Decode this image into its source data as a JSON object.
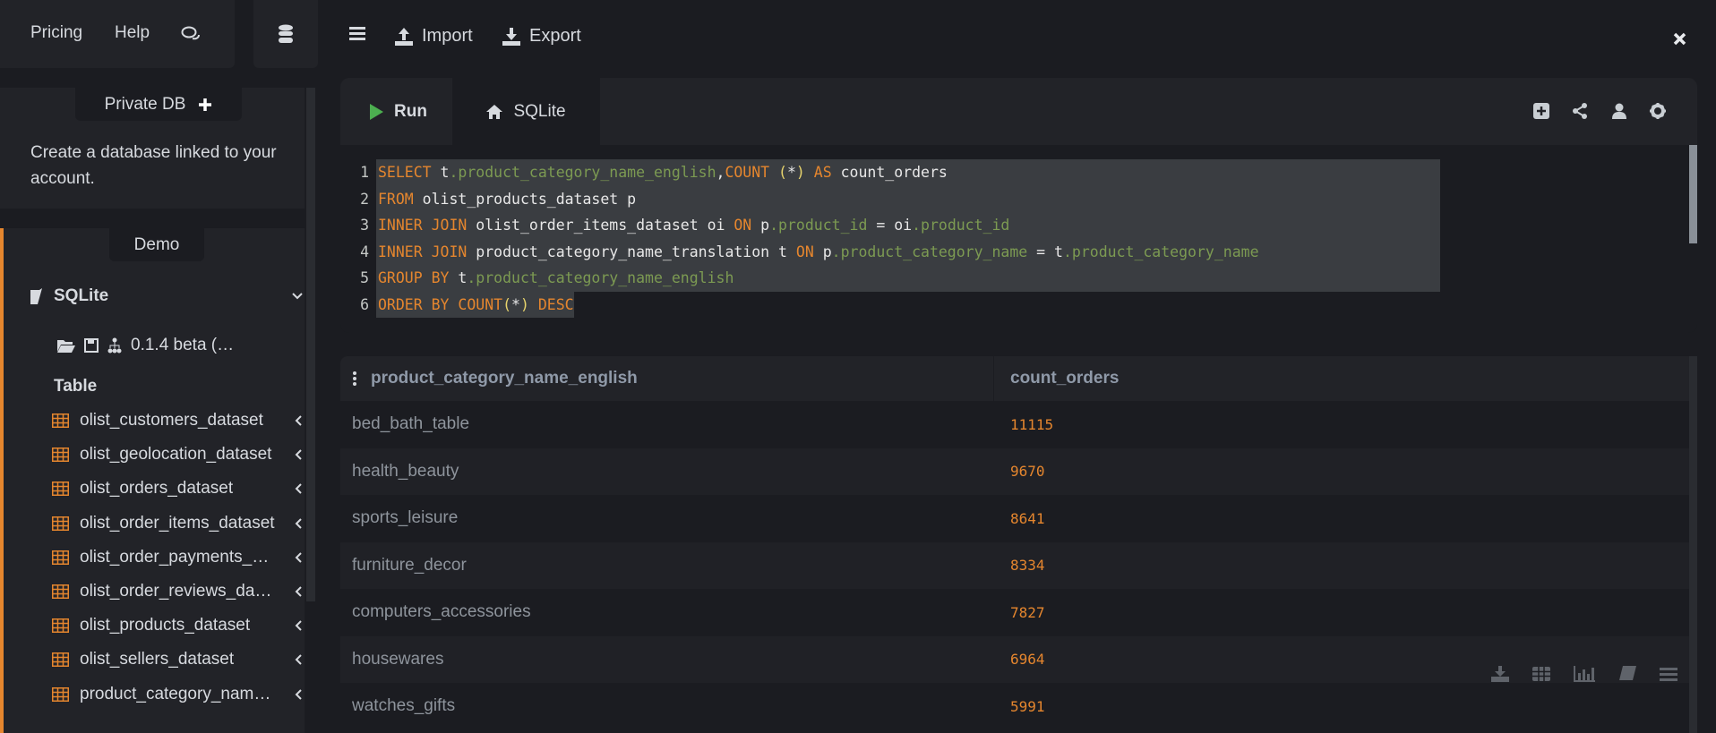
{
  "topnav": {
    "pricing": "Pricing",
    "help": "Help",
    "chat_icon": "comments-icon",
    "db_icon": "database-icon"
  },
  "toolbar": {
    "menu_icon": "bars-icon",
    "import": "Import",
    "export": "Export",
    "close_icon": "close-icon"
  },
  "sidebar": {
    "private_db": "Private DB",
    "private_db_desc": "Create a database linked to your account.",
    "demo": "Demo",
    "db_name": "SQLite",
    "version": "0.1.4 beta (…",
    "table_heading": "Table",
    "tables": [
      "olist_customers_dataset",
      "olist_geolocation_dataset",
      "olist_orders_dataset",
      "olist_order_items_dataset",
      "olist_order_payments_…",
      "olist_order_reviews_da…",
      "olist_products_dataset",
      "olist_sellers_dataset",
      "product_category_nam…"
    ]
  },
  "editor": {
    "run": "Run",
    "tab": "SQLite",
    "accent": "#e5862e",
    "run_color": "#4caf50",
    "lines": [
      "SELECT t.product_category_name_english,COUNT (*) AS count_orders",
      "FROM olist_products_dataset p",
      "INNER JOIN olist_order_items_dataset oi ON p.product_id = oi.product_id",
      "INNER JOIN product_category_name_translation t ON p.product_category_name = t.product_category_name",
      "GROUP BY t.product_category_name_english",
      "ORDER BY COUNT(*) DESC"
    ]
  },
  "results": {
    "columns": [
      "product_category_name_english",
      "count_orders"
    ],
    "rows": [
      [
        "bed_bath_table",
        "11115"
      ],
      [
        "health_beauty",
        "9670"
      ],
      [
        "sports_leisure",
        "8641"
      ],
      [
        "furniture_decor",
        "8334"
      ],
      [
        "computers_accessories",
        "7827"
      ],
      [
        "housewares",
        "6964"
      ],
      [
        "watches_gifts",
        "5991"
      ]
    ]
  }
}
